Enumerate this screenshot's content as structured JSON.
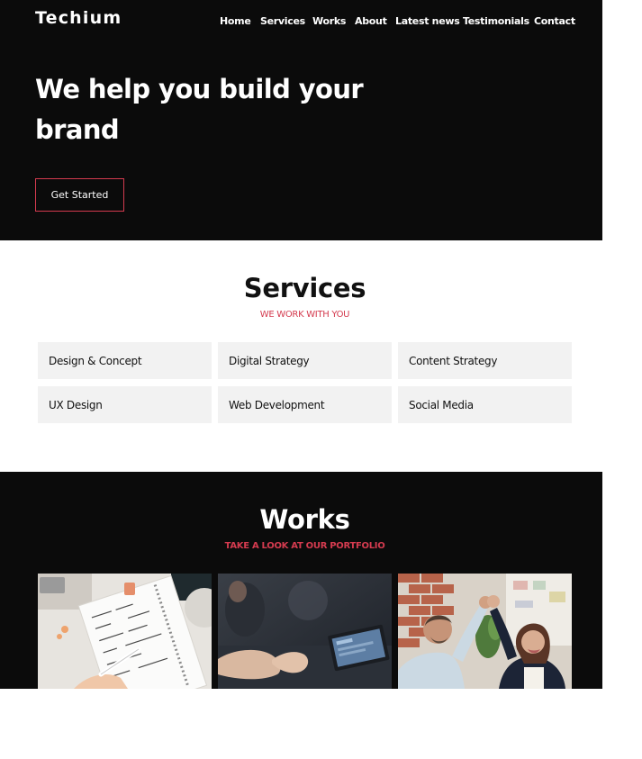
{
  "brand": {
    "name": "Techium"
  },
  "nav": {
    "items": [
      {
        "label": "Home"
      },
      {
        "label": "Services"
      },
      {
        "label": "Works"
      },
      {
        "label": "About"
      },
      {
        "label": "Latest news"
      },
      {
        "label": "Testimonials"
      },
      {
        "label": "Contact"
      }
    ]
  },
  "hero": {
    "title": "We help you build your brand",
    "cta_label": "Get Started"
  },
  "services": {
    "title": "Services",
    "subtitle": "WE WORK WITH YOU",
    "items": [
      {
        "label": "Design & Concept"
      },
      {
        "label": "Digital Strategy"
      },
      {
        "label": "Content Strategy"
      },
      {
        "label": "UX Design"
      },
      {
        "label": "Web Development"
      },
      {
        "label": "Social Media"
      }
    ]
  },
  "works": {
    "title": "Works",
    "subtitle": "TAKE A LOOK AT OUR PORTFOLIO",
    "items": [
      {
        "image": "notebook-planning-photo"
      },
      {
        "image": "meeting-laptop-photo"
      },
      {
        "image": "high-five-team-photo"
      }
    ]
  },
  "colors": {
    "dark_background": "#0b0b0b",
    "accent": "#d43b4f",
    "card_background": "#f2f2f2"
  }
}
